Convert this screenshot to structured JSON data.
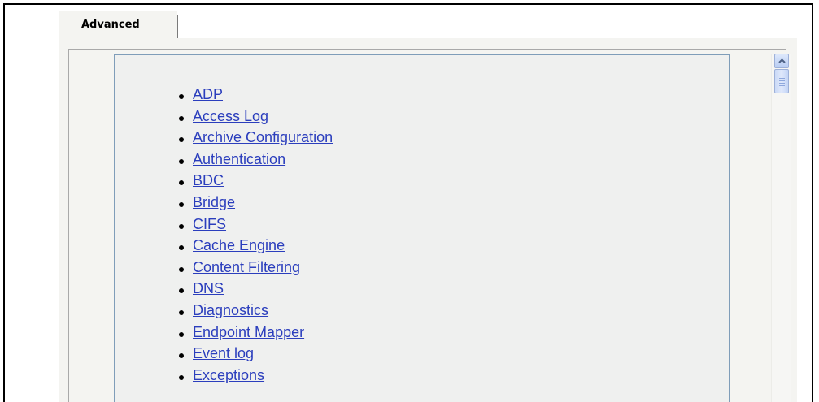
{
  "tabs": [
    {
      "label": "Advanced"
    }
  ],
  "links": [
    {
      "label": "ADP"
    },
    {
      "label": "Access Log"
    },
    {
      "label": "Archive Configuration"
    },
    {
      "label": "Authentication"
    },
    {
      "label": "BDC"
    },
    {
      "label": "Bridge"
    },
    {
      "label": "CIFS"
    },
    {
      "label": "Cache Engine"
    },
    {
      "label": "Content Filtering"
    },
    {
      "label": "DNS"
    },
    {
      "label": "Diagnostics"
    },
    {
      "label": "Endpoint Mapper"
    },
    {
      "label": "Event log"
    },
    {
      "label": "Exceptions"
    }
  ],
  "icons": {
    "scroll_up": "chevron-up-icon",
    "thumb_grip": "grip-icon"
  },
  "colors": {
    "link": "#2b3ebd",
    "content_border": "#7f9db9",
    "panel_bg": "#f4f4f1"
  }
}
